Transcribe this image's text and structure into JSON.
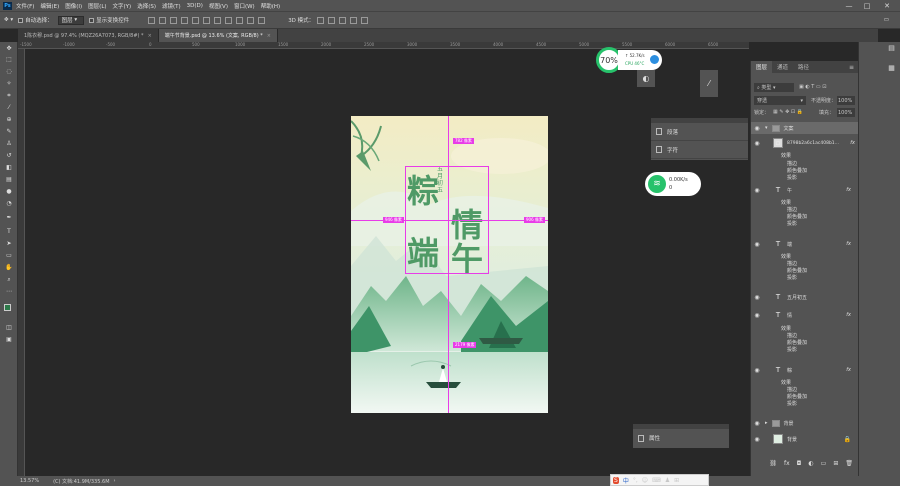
{
  "app": {
    "logo": "Ps"
  },
  "menu": [
    "文件(F)",
    "编辑(E)",
    "图像(I)",
    "图层(L)",
    "文字(Y)",
    "选择(S)",
    "滤镜(T)",
    "3D(D)",
    "视图(V)",
    "窗口(W)",
    "帮助(H)"
  ],
  "window_controls": {
    "minimize": "—",
    "maximize": "□",
    "close": "✕"
  },
  "options": {
    "auto_select_label": "自动选择：",
    "auto_select_value": "图层",
    "show_transform_label": "显示变换控件",
    "mode_3d_label": "3D 模式："
  },
  "tabs": [
    {
      "label": "1陈衣穆.psd @ 97.4% (MQZ26A7073, RGB/8#) *",
      "close": "×"
    },
    {
      "label": "端午节背景.psd @ 13.6% (文案, RGB/8) *",
      "close": "×"
    }
  ],
  "ruler_ticks": [
    "-1500",
    "-1000",
    "-500",
    "0",
    "500",
    "1000",
    "1500",
    "2000",
    "2500",
    "3000",
    "3500",
    "4000",
    "4500",
    "5000",
    "5500",
    "6000",
    "6500"
  ],
  "artwork": {
    "title_chars": [
      "粽",
      "情",
      "端",
      "午"
    ],
    "date_text": "五月初五"
  },
  "measurements": {
    "top": "782 像素",
    "left": "946 像素",
    "right": "906 像素",
    "bottom": "2179 像素"
  },
  "hud": {
    "percent": "70%",
    "upload": "↑ 52.7K/s",
    "cpu": "CPU 46°C"
  },
  "net_widget": {
    "speed": "0.00K/s",
    "count": "0"
  },
  "panel_strip": {
    "paragraph": "段落",
    "character": "字符"
  },
  "props_strip": {
    "label": "属性"
  },
  "layers": {
    "tabs": [
      "图层",
      "通道",
      "路径"
    ],
    "filter_kind": "类型",
    "blend_mode": "穿透",
    "opacity_label": "不透明度：",
    "opacity_value": "100%",
    "lock_label": "锁定：",
    "fill_label": "填充：",
    "fill_value": "100%",
    "rows": [
      {
        "name": "文案",
        "kind": "group",
        "thumb": "▸"
      },
      {
        "name": "8798b2a6c1ac408b1...",
        "kind": "smart",
        "thumb": "▫",
        "fx": "fx",
        "subs": [
          "效果",
          "描边",
          "颜色叠加",
          "投影"
        ]
      },
      {
        "name": "午",
        "kind": "text",
        "thumb": "T",
        "fx": "fx",
        "subs": [
          "效果",
          "描边",
          "颜色叠加",
          "投影"
        ]
      },
      {
        "name": "端",
        "kind": "text",
        "thumb": "T",
        "fx": "fx",
        "subs": [
          "效果",
          "描边",
          "颜色叠加",
          "投影"
        ]
      },
      {
        "name": "五月初五",
        "kind": "text",
        "thumb": "T"
      },
      {
        "name": "情",
        "kind": "text",
        "thumb": "T",
        "fx": "fx",
        "subs": [
          "效果",
          "描边",
          "颜色叠加",
          "投影"
        ]
      },
      {
        "name": "粽",
        "kind": "text",
        "thumb": "T",
        "fx": "fx",
        "subs": [
          "效果",
          "描边",
          "颜色叠加",
          "投影"
        ]
      },
      {
        "name": "背景",
        "kind": "group",
        "thumb": "▸"
      },
      {
        "name": "背景",
        "kind": "bg",
        "thumb": ""
      }
    ]
  },
  "status": {
    "zoom": "13.57%",
    "doc": "(C) 文档:41.9M/335.6M"
  },
  "ime": [
    "S",
    "中",
    "°,",
    "☺",
    "⌨",
    "♟",
    "⊞"
  ],
  "colors": {
    "ui": "#535353",
    "canvas_bg": "#282828",
    "guide": "#e83ce8",
    "title_green": "#4f9a66",
    "accent": "#31a8ff"
  }
}
